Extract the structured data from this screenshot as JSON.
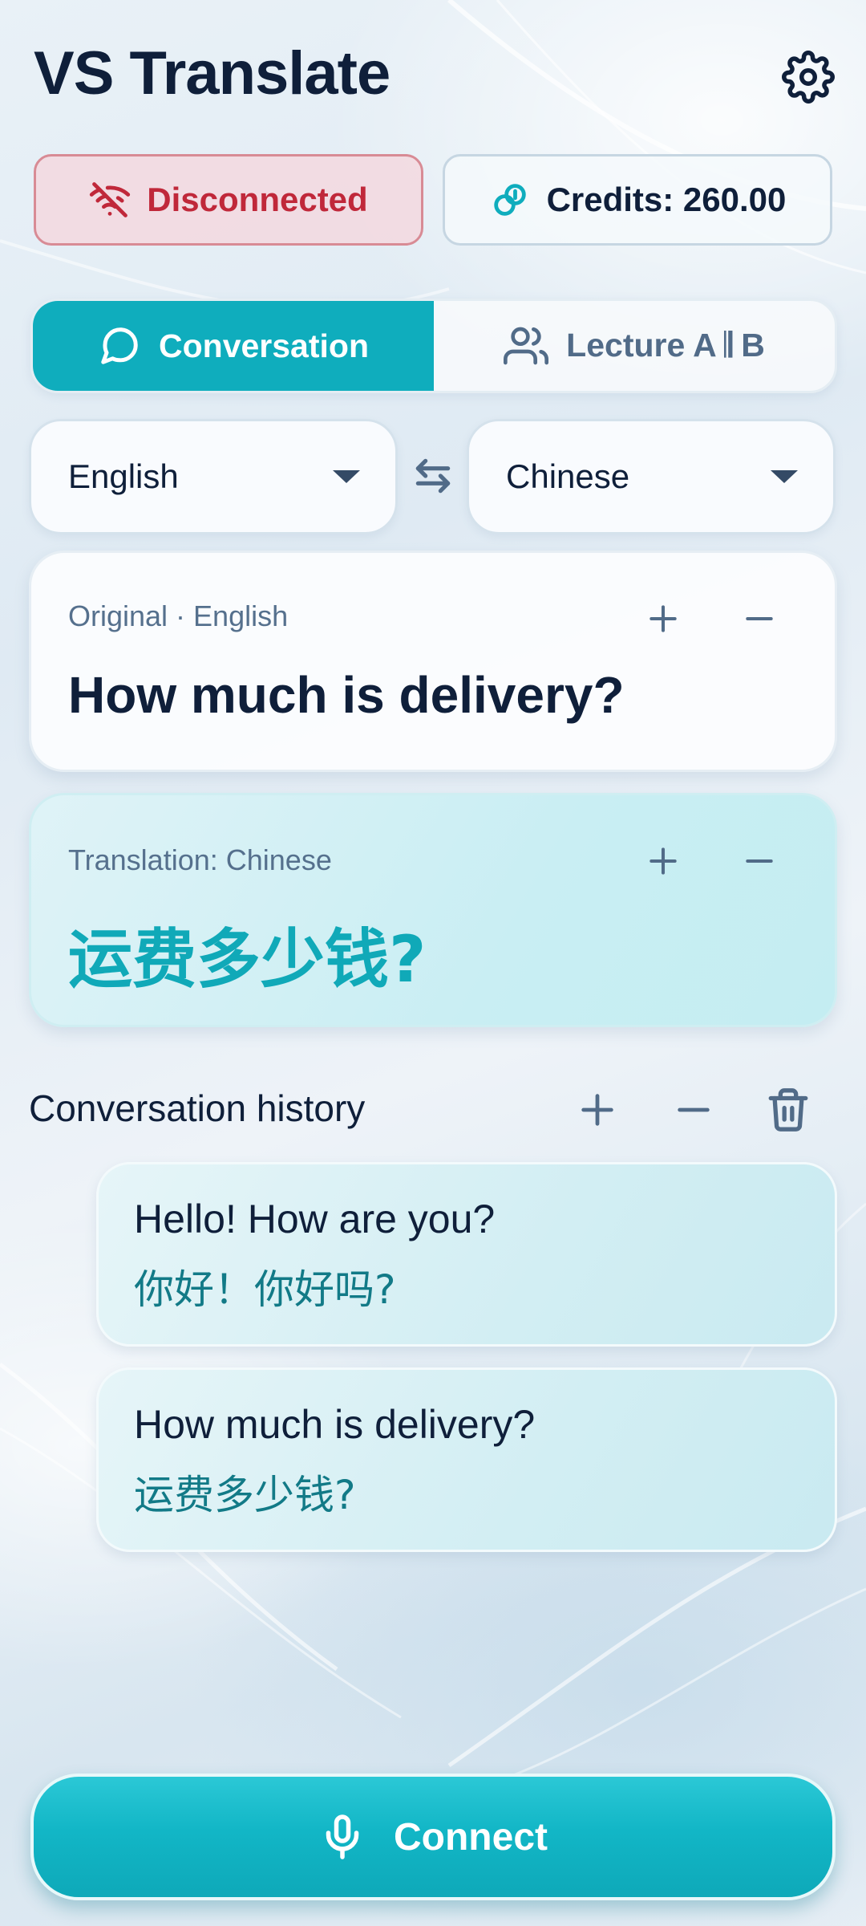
{
  "app": {
    "title": "VS Translate"
  },
  "status": {
    "connection_label": "Disconnected",
    "credits_label": "Credits: 260.00"
  },
  "mode_tabs": [
    {
      "label": "Conversation",
      "icon": "chat-bubble-icon",
      "active": true
    },
    {
      "label": "Lecture A 𝄂 B",
      "icon": "people-icon",
      "active": false
    }
  ],
  "languages": {
    "source": "English",
    "target": "Chinese"
  },
  "original_card": {
    "label": "Original · English",
    "text": "How much is delivery?"
  },
  "translation_card": {
    "label": "Translation: Chinese",
    "text": "运费多少钱?"
  },
  "history": {
    "title": "Conversation history",
    "items": [
      {
        "source": "Hello! How are you?",
        "translation": "你好！你好吗?"
      },
      {
        "source": "How much is delivery?",
        "translation": "运费多少钱?"
      }
    ]
  },
  "connect_button": {
    "label": "Connect"
  },
  "colors": {
    "accent": "#0fadbd",
    "error": "#c0283a",
    "text_dark": "#0f1f3a",
    "text_muted": "#516b88"
  }
}
